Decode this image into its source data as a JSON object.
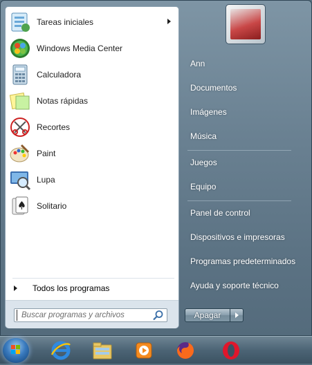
{
  "programs": [
    {
      "label": "Tareas iniciales",
      "icon": "getting-started-icon",
      "has_submenu": true
    },
    {
      "label": "Windows Media Center",
      "icon": "media-center-icon"
    },
    {
      "label": "Calculadora",
      "icon": "calculator-icon"
    },
    {
      "label": "Notas rápidas",
      "icon": "sticky-notes-icon"
    },
    {
      "label": "Recortes",
      "icon": "snipping-tool-icon"
    },
    {
      "label": "Paint",
      "icon": "paint-icon"
    },
    {
      "label": "Lupa",
      "icon": "magnifier-icon"
    },
    {
      "label": "Solitario",
      "icon": "solitaire-icon"
    }
  ],
  "all_programs_label": "Todos los programas",
  "search": {
    "placeholder": "Buscar programas y archivos"
  },
  "right_links": [
    "Ann",
    "Documentos",
    "Imágenes",
    "Música",
    "Juegos",
    "Equipo",
    "Panel de control",
    "Dispositivos e impresoras",
    "Programas predeterminados",
    "Ayuda y soporte técnico"
  ],
  "shutdown_label": "Apagar",
  "taskbar_items": [
    "start-orb",
    "internet-explorer-icon",
    "file-explorer-icon",
    "media-player-icon",
    "firefox-icon",
    "opera-icon"
  ],
  "colors": {
    "menu_bg": "#6a8192",
    "taskbar": "#4c6475",
    "accent_blue": "#3a7bbf"
  }
}
